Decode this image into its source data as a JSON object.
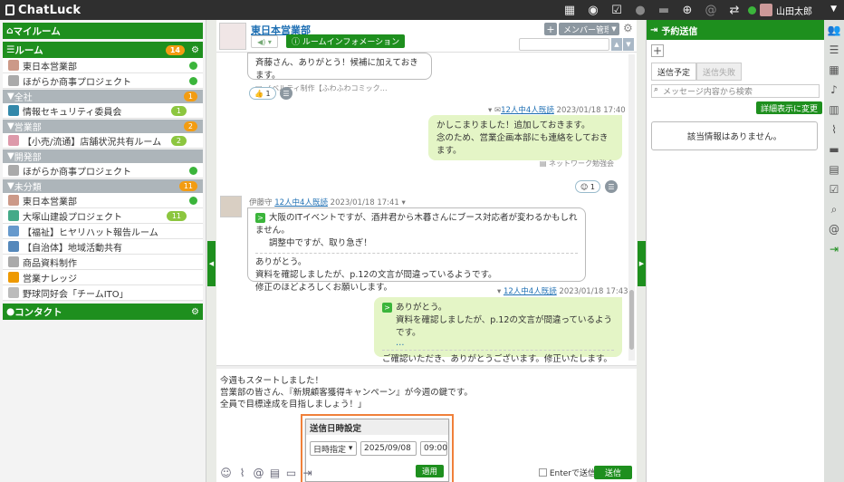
{
  "app": {
    "title": "ChatLuck",
    "user": "山田太郎"
  },
  "top_icons": [
    "qr-icon",
    "chat-icon",
    "task-icon",
    "person-icon",
    "message-icon",
    "globe-icon",
    "at-icon",
    "swap-icon"
  ],
  "left": {
    "myroom": "マイルーム",
    "room_header": "ルーム",
    "room_count": "14",
    "rooms_top": [
      {
        "label": "東日本営業部",
        "online": true
      },
      {
        "label": "ほがらか商事プロジェクト",
        "online": true
      }
    ],
    "sections": [
      {
        "label": "全社",
        "count": "1",
        "rooms": [
          {
            "label": "情報セキュリティ委員会",
            "badge": "1"
          }
        ]
      },
      {
        "label": "営業部",
        "count": "2",
        "rooms": [
          {
            "label": "【小売/流通】店舗状況共有ルーム",
            "badge": "2"
          }
        ]
      },
      {
        "label": "開発部",
        "count": "",
        "rooms": [
          {
            "label": "ほがらか商事プロジェクト",
            "online": true
          }
        ]
      },
      {
        "label": "未分類",
        "count": "11",
        "rooms": [
          {
            "label": "東日本営業部",
            "online": true
          },
          {
            "label": "大塚山建設プロジェクト",
            "badge": "11"
          },
          {
            "label": "【福祉】ヒヤリハット報告ルーム"
          },
          {
            "label": "【自治体】地域活動共有"
          },
          {
            "label": "商品資料制作"
          },
          {
            "label": "営業ナレッジ"
          },
          {
            "label": "野球同好会「チームITO」"
          }
        ]
      }
    ],
    "contacts": "コンタクト"
  },
  "room": {
    "name": "東日本営業部",
    "info_label": "ルームインフォメーション",
    "member_label": "メンバー管理",
    "add_label": "+",
    "search_placeholder": ""
  },
  "messages": {
    "m1": {
      "text": "斉藤さん、ありがとう！候補に加えておきます。",
      "note": "ノベルティ制作【ふわふわコミック…",
      "react": "1"
    },
    "m2": {
      "read": "12人中4人既読",
      "time": "2023/01/18 17:40",
      "line1": "かしこまりました！追加しておきます。",
      "line2": "念のため、営業企画本部にも連絡をしておきます。",
      "note": "ネットワーク勉強会",
      "react": "1"
    },
    "m3": {
      "author": "伊藤守",
      "read": "12人中4人既読",
      "time": "2023/01/18 17:41",
      "quote1": "大阪のITイベントですが、酒井君から木暮さんにブース対応者が変わるかもしれません。",
      "quote2": "調整中ですが、取り急ぎ！",
      "line1": "ありがとう。",
      "line2": "資料を確認しましたが、p.12の文言が間違っているようです。",
      "line3": "修正のほどよろしくお願いします。"
    },
    "m4": {
      "read": "12人中4人既読",
      "time": "2023/01/18 17:43",
      "quote1": "ありがとう。",
      "quote2": "資料を確認しましたが、p.12の文言が間違っているようです。",
      "quote3": "…",
      "line1": "ご確認いただき、ありがとうございます。修正いたします。"
    }
  },
  "compose": {
    "line1": "今週もスタートしました！",
    "line2": "営業部の皆さん、『新規顧客獲得キャンペーン』が今週の鍵です。",
    "line3": "全員で目標達成を目指しましょう！」",
    "enter_label": "Enterで送信",
    "send_label": "送信"
  },
  "schedule_popup": {
    "title": "送信日時設定",
    "mode": "日時指定",
    "date": "2025/09/08",
    "time": "09:00",
    "apply": "適用"
  },
  "right": {
    "header": "予約送信",
    "tab_scheduled": "送信予定",
    "tab_failed": "送信失敗",
    "search_placeholder": "メッセージ内容から検索",
    "detail_btn": "詳細表示に変更",
    "empty": "該当情報はありません。"
  },
  "colors": {
    "brand": "#1e8f1e",
    "badge_orange": "#f39c12",
    "badge_green": "#8cc63f",
    "highlight": "#f0803a"
  }
}
